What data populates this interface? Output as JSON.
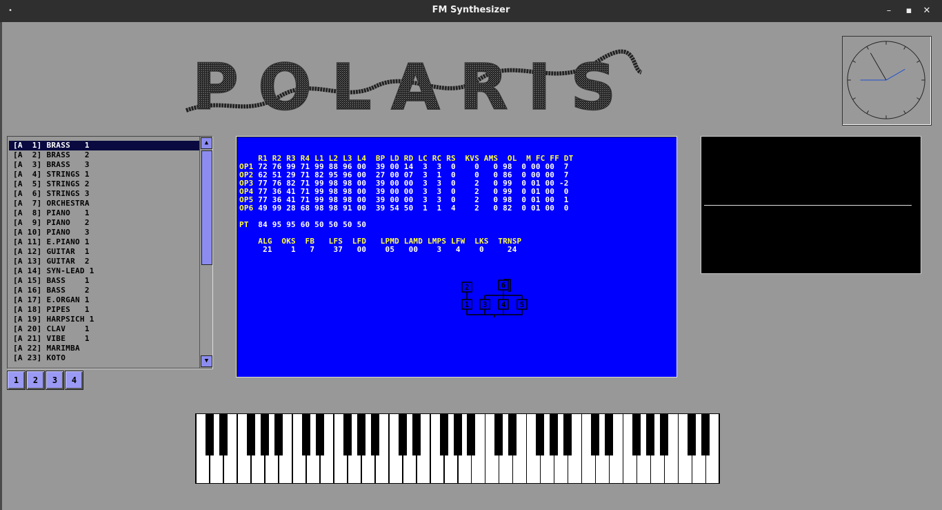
{
  "window": {
    "title": "FM Synthesizer",
    "menu_icon": "•",
    "minimize": "–",
    "maximize": "▪",
    "close": "✕"
  },
  "logo": {
    "text": "POLARIS"
  },
  "clock": {
    "hour_angle_deg": 60,
    "minute_angle_deg": 270,
    "second_angle_deg": 330
  },
  "patches": [
    "[A  1] BRASS   1",
    "[A  2] BRASS   2",
    "[A  3] BRASS   3",
    "[A  4] STRINGS 1",
    "[A  5] STRINGS 2",
    "[A  6] STRINGS 3",
    "[A  7] ORCHESTRA",
    "[A  8] PIANO   1",
    "[A  9] PIANO   2",
    "[A 10] PIANO   3",
    "[A 11] E.PIANO 1",
    "[A 12] GUITAR  1",
    "[A 13] GUITAR  2",
    "[A 14] SYN-LEAD 1",
    "[A 15] BASS    1",
    "[A 16] BASS    2",
    "[A 17] E.ORGAN 1",
    "[A 18] PIPES   1",
    "[A 19] HARPSICH 1",
    "[A 20] CLAV    1",
    "[A 21] VIBE    1",
    "[A 22] MARIMBA",
    "[A 23] KOTO"
  ],
  "selected_patch_index": 0,
  "scroll": {
    "up": "▲",
    "down": "▼"
  },
  "banks": [
    "1",
    "2",
    "3",
    "4"
  ],
  "params": {
    "op_header": "    R1 R2 R3 R4 L1 L2 L3 L4  BP LD RD LC RC RS  KVS AMS  OL  M FC FF DT",
    "operators": [
      {
        "label": "OP1",
        "values": " 72 76 99 71 99 88 96 00  39 00 14  3  3  0    0   0 98  0 00 00  7"
      },
      {
        "label": "OP2",
        "values": " 62 51 29 71 82 95 96 00  27 00 07  3  1  0    0   0 86  0 00 00  7"
      },
      {
        "label": "OP3",
        "values": " 77 76 82 71 99 98 98 00  39 00 00  3  3  0    2   0 99  0 01 00 -2"
      },
      {
        "label": "OP4",
        "values": " 77 36 41 71 99 98 98 00  39 00 00  3  3  0    2   0 99  0 01 00  0"
      },
      {
        "label": "OP5",
        "values": " 77 36 41 71 99 98 98 00  39 00 00  3  3  0    2   0 98  0 01 00  1"
      },
      {
        "label": "OP6",
        "values": " 49 99 28 68 98 98 91 00  39 54 50  1  1  4    2   0 82  0 01 00  0"
      }
    ],
    "pt_label": "PT",
    "pt_values": "  84 95 95 60 50 50 50 50",
    "global_header": "    ALG  OKS  FB   LFS  LFD   LPMD LAMD LMPS LFW  LKS  TRNSP",
    "global_values": "     21    1   7    37   00    05   00    3   4    0     24",
    "algorithm_boxes": [
      "1",
      "2",
      "3",
      "4",
      "5",
      "6"
    ]
  },
  "colors": {
    "background": "#989898",
    "param_bg": "#0000ff",
    "param_header": "#ffff40",
    "param_values": "#ffffff",
    "button": "#9a9af4",
    "clock_hand_blue": "#2050d0"
  }
}
